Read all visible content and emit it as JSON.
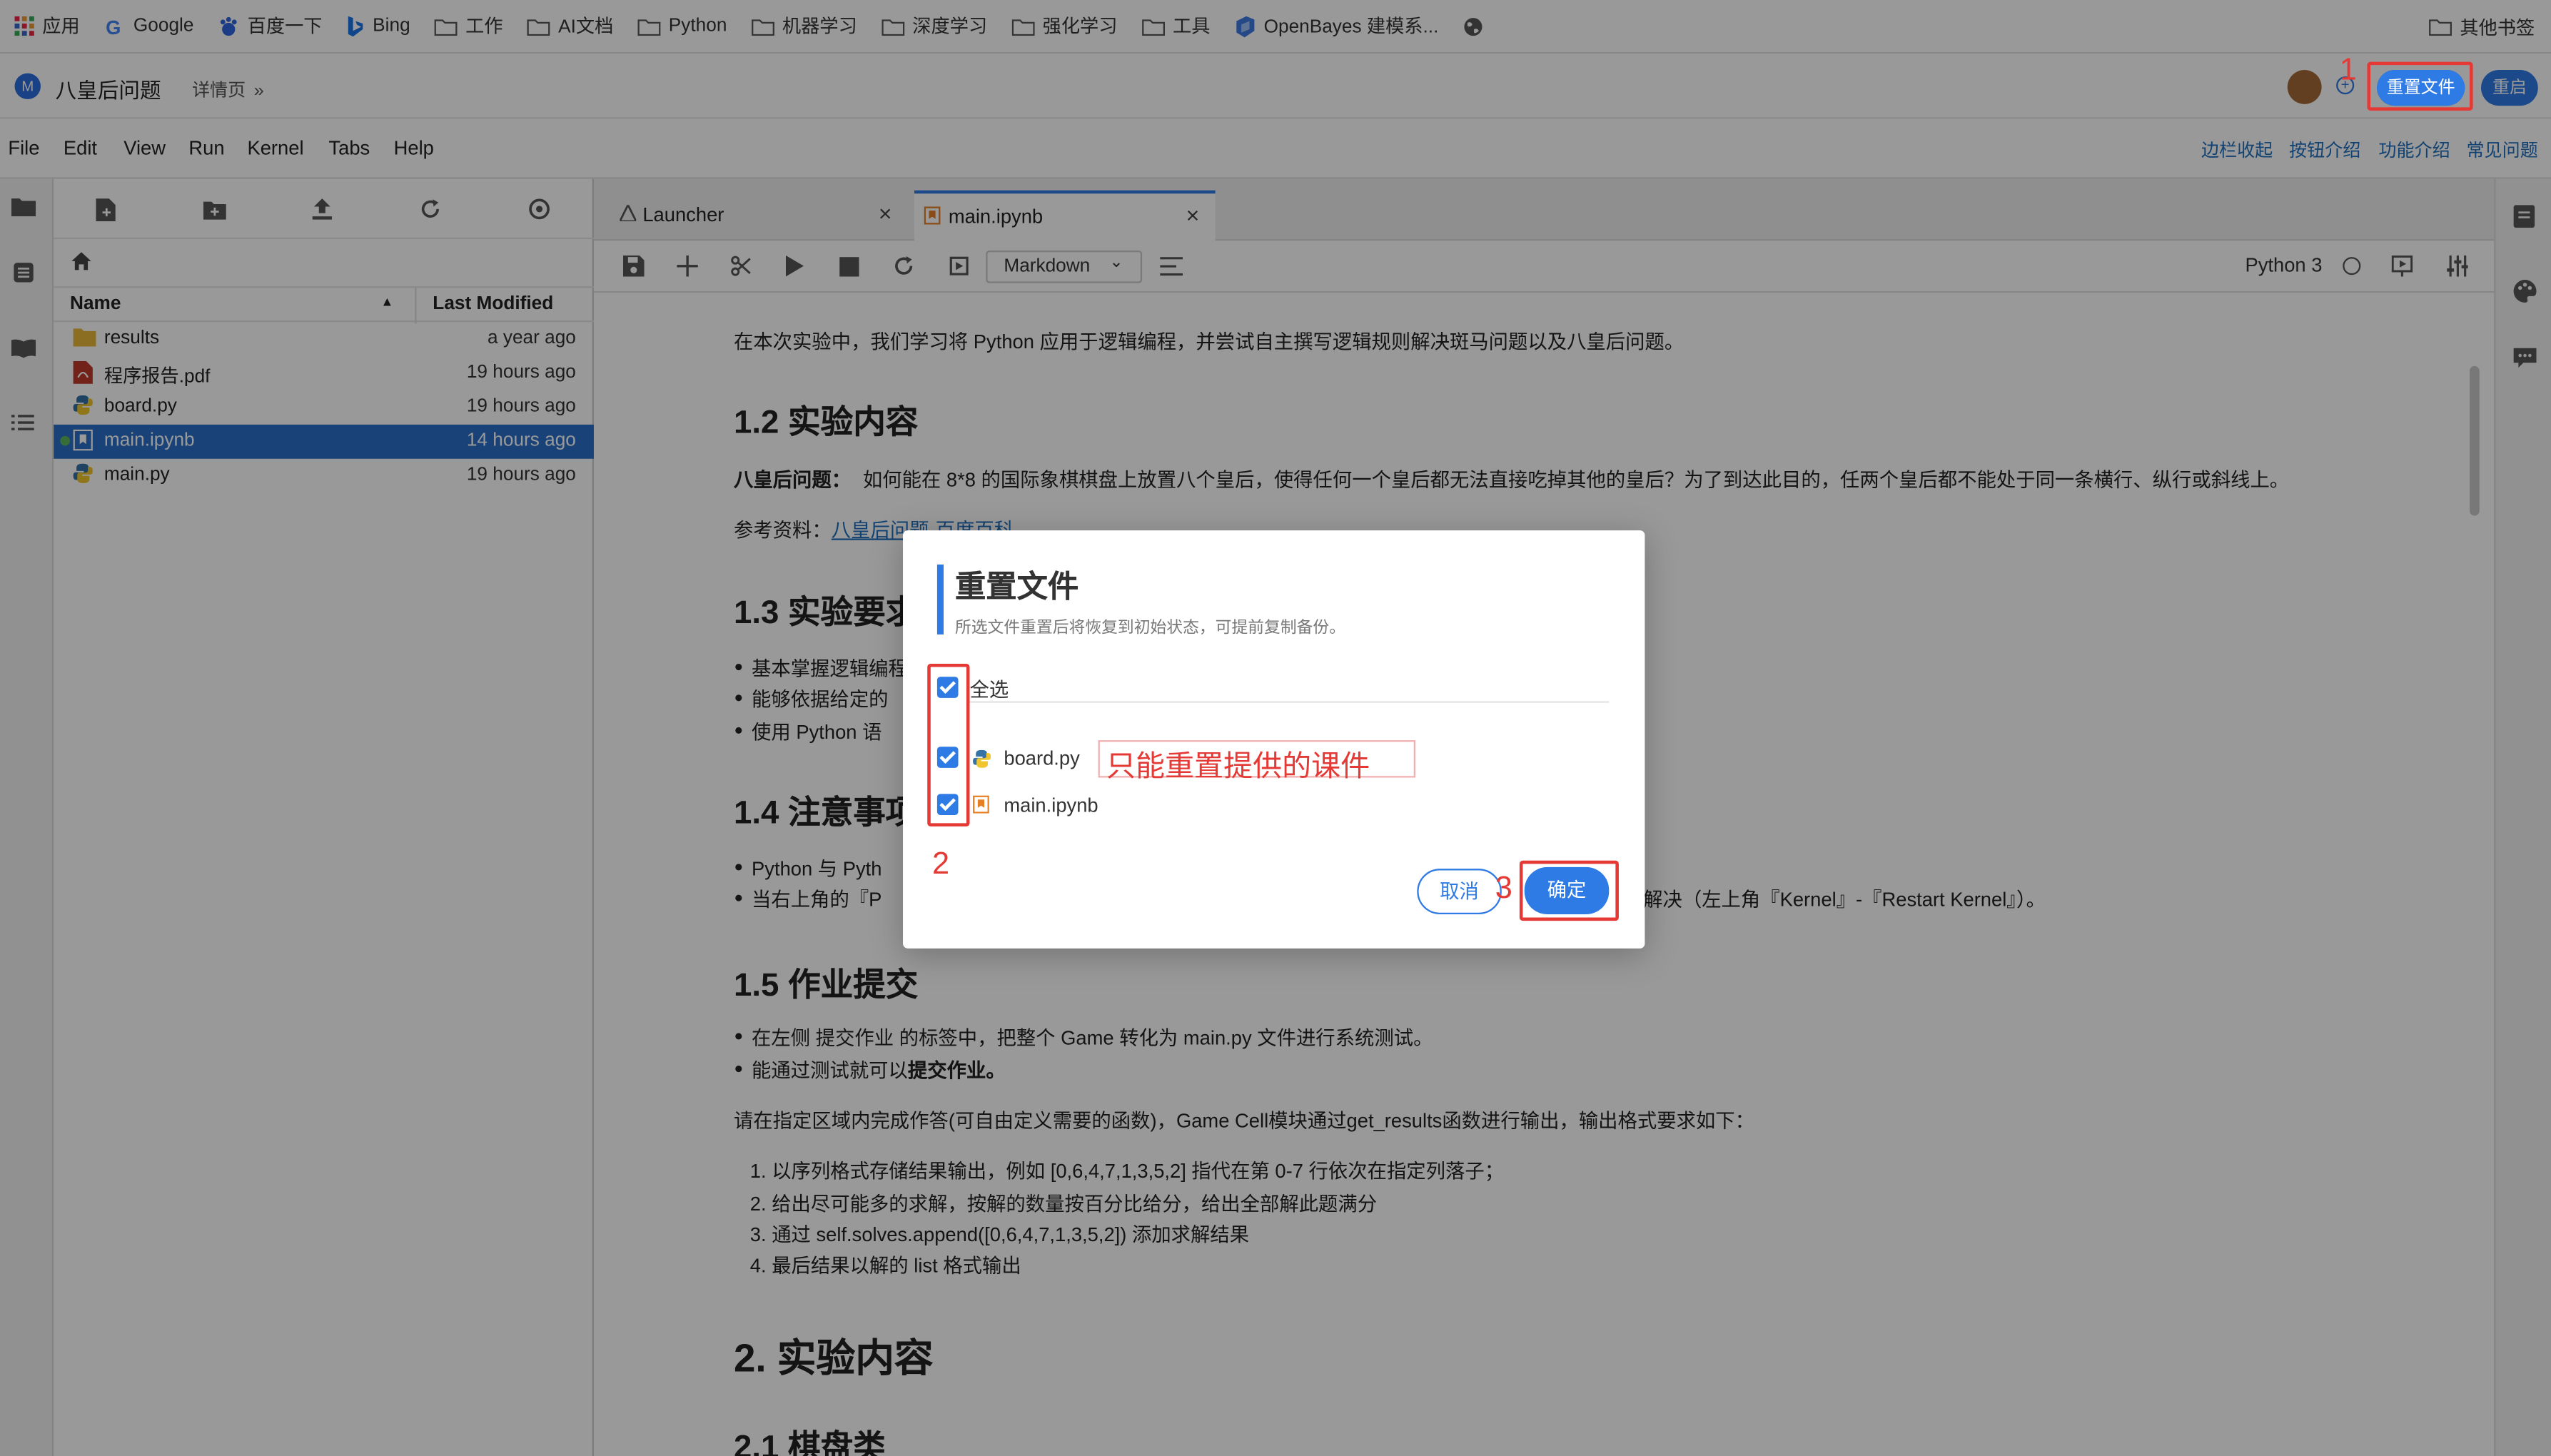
{
  "bookmarks": [
    {
      "label": "应用",
      "icon": "apps-grid-icon"
    },
    {
      "label": "Google",
      "icon": "google-icon"
    },
    {
      "label": "百度一下",
      "icon": "baidu-icon"
    },
    {
      "label": "Bing",
      "icon": "bing-icon"
    },
    {
      "label": "工作",
      "icon": "folder-icon"
    },
    {
      "label": "AI文档",
      "icon": "folder-icon"
    },
    {
      "label": "Python",
      "icon": "folder-icon"
    },
    {
      "label": "机器学习",
      "icon": "folder-icon"
    },
    {
      "label": "深度学习",
      "icon": "folder-icon"
    },
    {
      "label": "强化学习",
      "icon": "folder-icon"
    },
    {
      "label": "工具",
      "icon": "folder-icon"
    },
    {
      "label": "OpenBayes 建模系...",
      "icon": "openbayes-icon"
    }
  ],
  "bookmarks_other": "其他书签",
  "app": {
    "title": "八皇后问题",
    "detail": "详情页",
    "logo": "M",
    "reset_button": "重置文件",
    "restart_button": "重启"
  },
  "menu": [
    "File",
    "Edit",
    "View",
    "Run",
    "Kernel",
    "Tabs",
    "Help"
  ],
  "help_links": [
    "边栏收起",
    "按钮介绍",
    "功能介绍",
    "常见问题"
  ],
  "filebrowser": {
    "col_name": "Name",
    "col_modified": "Last Modified",
    "files": [
      {
        "name": "results",
        "modified": "a year ago",
        "icon": "folder-icon"
      },
      {
        "name": "程序报告.pdf",
        "modified": "19 hours ago",
        "icon": "pdf-icon"
      },
      {
        "name": "board.py",
        "modified": "19 hours ago",
        "icon": "python-icon"
      },
      {
        "name": "main.ipynb",
        "modified": "14 hours ago",
        "icon": "notebook-icon"
      },
      {
        "name": "main.py",
        "modified": "19 hours ago",
        "icon": "python-icon"
      }
    ]
  },
  "tabs": [
    {
      "label": "Launcher"
    },
    {
      "label": "main.ipynb"
    }
  ],
  "notebook": {
    "cell_type": "Markdown",
    "kernel": "Python 3"
  },
  "content": {
    "p_intro": "在本次实验中，我们学习将 Python 应用于逻辑编程，并尝试自主撰写逻辑规则解决斑马问题以及八皇后问题。",
    "h_12": "1.2 实验内容",
    "p_problem_bold": "八皇后问题：",
    "p_problem": "如何能在 8*8 的国际象棋棋盘上放置八个皇后，使得任何一个皇后都无法直接吃掉其他的皇后？为了到达此目的，任两个皇后都不能处于同一条横行、纵行或斜线上。",
    "p_ref_label": "参考资料：",
    "p_ref_link": "八皇后问题-百度百科",
    "h_13": "1.3 实验要求",
    "b13": [
      "基本掌握逻辑编程",
      "能够依据给定的",
      "使用 Python 语"
    ],
    "h_14": "1.4 注意事项",
    "b14": [
      "Python 与 Pyth",
      "当右上角的『P"
    ],
    "b14_tail": "解决（左上角『Kernel』-『Restart Kernel』）。",
    "h_15": "1.5 作业提交",
    "b15_1": "在左侧 提交作业 的标签中，把整个 Game 转化为 main.py 文件进行系统测试。",
    "b15_2_a": "能通过测试就可以",
    "b15_2_b": "提交作业。",
    "p_instr": "请在指定区域内完成作答(可自由定义需要的函数)，Game Cell模块通过get_results函数进行输出，输出格式要求如下：",
    "ol": [
      "以序列格式存储结果输出，例如 [0,6,4,7,1,3,5,2] 指代在第 0-7 行依次在指定列落子；",
      "给出尽可能多的求解，按解的数量按百分比给分，给出全部解此题满分",
      "通过 self.solves.append([0,6,4,7,1,3,5,2]) 添加求解结果",
      "最后结果以解的 list 格式输出"
    ],
    "h_2": "2. 实验内容",
    "h_21": "2.1 棋盘类"
  },
  "dialog": {
    "title": "重置文件",
    "subtitle": "所选文件重置后将恢复到初始状态，可提前复制备份。",
    "select_all": "全选",
    "files": [
      "board.py",
      "main.ipynb"
    ],
    "cancel": "取消",
    "confirm": "确定",
    "annotation": "只能重置提供的课件",
    "marks": [
      "1",
      "2",
      "3"
    ]
  },
  "colors": {
    "accent": "#2f7be5",
    "annotation": "#e53935",
    "selected_row": "#2b6fc9"
  }
}
